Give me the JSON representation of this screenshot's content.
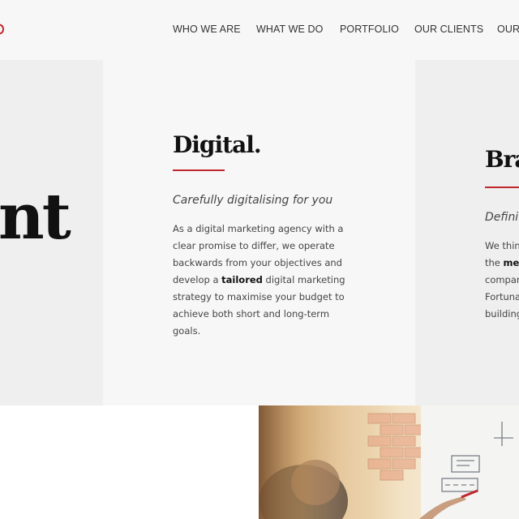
{
  "nav": {
    "items": [
      "WHO WE ARE",
      "WHAT WE DO",
      "PORTFOLIO",
      "OUR CLIENTS",
      "OUR"
    ]
  },
  "left_panel": {
    "heading_fragment": "nt"
  },
  "center_panel": {
    "heading": "Digital.",
    "tagline": "Carefully digitalising for you",
    "body_before": "As a digital marketing agency with a clear promise to differ, we operate backwards from your objectives and develop a ",
    "body_bold": "tailored",
    "body_after": " digital marketing strategy to maximise your budget to achieve both short and long-term goals."
  },
  "right_panel": {
    "heading": "Bra",
    "tagline": "Defini",
    "lines": [
      "We thin",
      "the ",
      "compar",
      "Fortuna",
      "building"
    ],
    "line2_bold": "me"
  },
  "colors": {
    "accent": "#c0272d",
    "text": "#222222"
  }
}
